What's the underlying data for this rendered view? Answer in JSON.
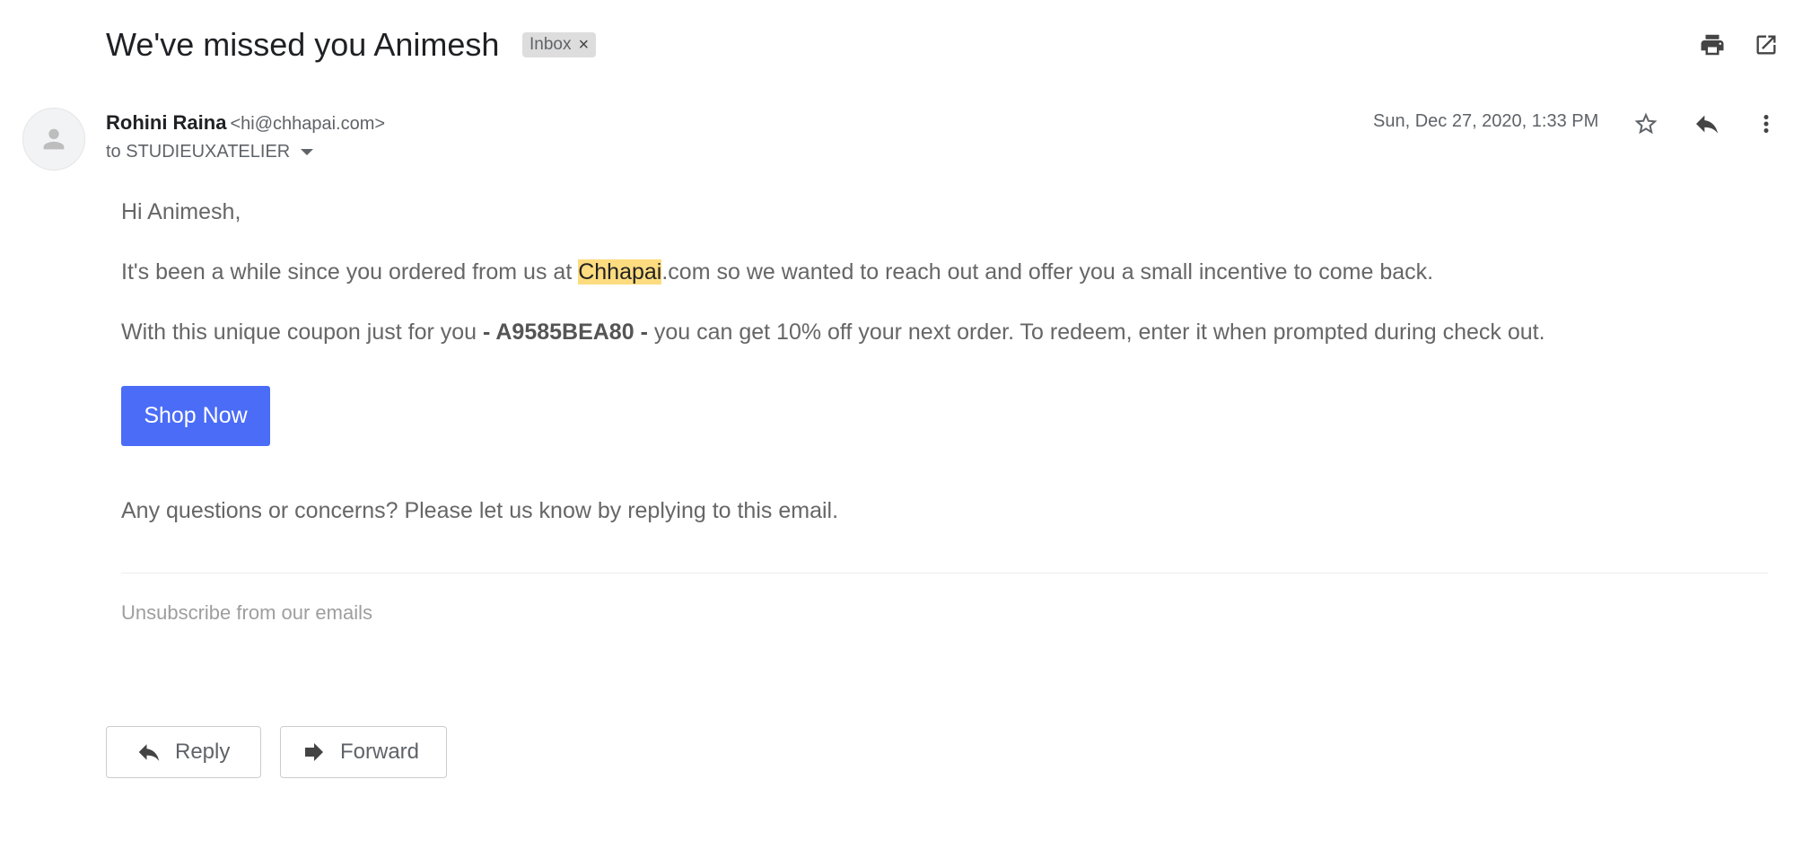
{
  "header": {
    "subject": "We've missed you Animesh",
    "label_chip": "Inbox",
    "label_remove": "×"
  },
  "message": {
    "sender_name": "Rohini Raina",
    "sender_email": "<hi@chhapai.com>",
    "to_line": "to STUDIEUXATELIER",
    "date": "Sun, Dec 27, 2020, 1:33 PM"
  },
  "body": {
    "greeting": "Hi Animesh,",
    "para1_before": "It's been a while since you ordered from us at ",
    "para1_highlight": "Chhapai",
    "para1_after": ".com so we wanted to reach out and offer you a small incentive to come back.",
    "para2_before": "With this unique coupon just for you ",
    "para2_coupon": "- A9585BEA80 -",
    "para2_after": " you can get 10% off your next order. To redeem, enter it when prompted during check out.",
    "cta_label": "Shop Now",
    "questions": "Any questions or concerns? Please let us know by replying to this email.",
    "unsubscribe": "Unsubscribe from our emails"
  },
  "actions": {
    "reply_label": "Reply",
    "forward_label": "Forward"
  },
  "icons": {
    "print": "print-icon",
    "open_new_window": "open-in-new-window-icon",
    "star": "star-icon",
    "reply": "reply-icon",
    "more": "more-vert-icon",
    "avatar": "person-icon",
    "forward": "forward-icon"
  },
  "colors": {
    "cta_background": "#4a6cf7",
    "highlight": "#fddc80"
  }
}
